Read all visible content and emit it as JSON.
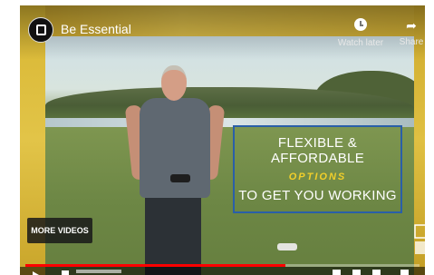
{
  "player": {
    "title": "Be Essential",
    "watch_later_label": "Watch later",
    "share_label": "Share",
    "more_videos_label": "MORE VIDEOS",
    "progress_fraction": 0.66
  },
  "caption": {
    "line1": "FLEXIBLE & AFFORDABLE",
    "line2": "OPTIONS",
    "line3": "TO GET YOU WORKING"
  },
  "colors": {
    "frame_yellow": "#d8b632",
    "caption_border": "#2a5fa8",
    "caption_accent": "#f2cf2a",
    "progress_red": "#ff0000"
  },
  "icons": {
    "watch_later": "clock-icon",
    "share": "share-arrow-icon",
    "channel": "channel-logo-icon",
    "watermark": "channel-watermark-icon"
  }
}
